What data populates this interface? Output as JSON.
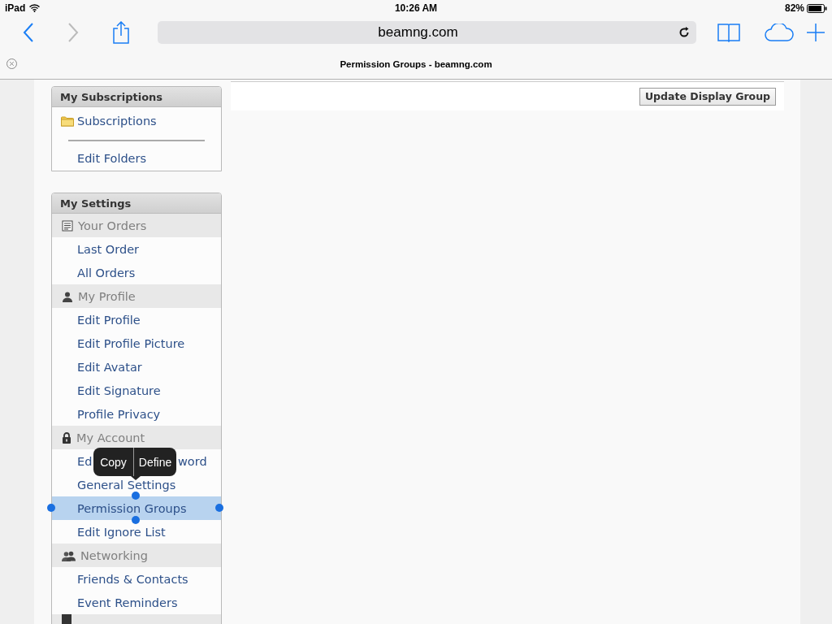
{
  "status_bar": {
    "device": "iPad",
    "time": "10:26 AM",
    "battery": "82%"
  },
  "toolbar": {
    "address": "beamng.com"
  },
  "tab": {
    "title": "Permission Groups - beamng.com"
  },
  "panel": {
    "button": "Update Display Group"
  },
  "sidebar": [
    {
      "title": "My Subscriptions",
      "items": [
        {
          "kind": "folder",
          "label": "Subscriptions",
          "selected": false
        },
        {
          "kind": "divider"
        },
        {
          "kind": "link",
          "label": "Edit Folders",
          "selected": false
        }
      ]
    },
    {
      "title": "My Settings",
      "items": [
        {
          "kind": "section",
          "label": "Your Orders"
        },
        {
          "kind": "link",
          "label": "Last Order",
          "selected": false
        },
        {
          "kind": "link",
          "label": "All Orders",
          "selected": false
        },
        {
          "kind": "section",
          "label": "My Profile"
        },
        {
          "kind": "link",
          "label": "Edit Profile",
          "selected": false
        },
        {
          "kind": "link",
          "label": "Edit Profile Picture",
          "selected": false
        },
        {
          "kind": "link",
          "label": "Edit Avatar",
          "selected": false
        },
        {
          "kind": "link",
          "label": "Edit Signature",
          "selected": false
        },
        {
          "kind": "link",
          "label": "Profile Privacy",
          "selected": false
        },
        {
          "kind": "section",
          "label": "My Account"
        },
        {
          "kind": "link",
          "label_parts": [
            "Ed",
            "word"
          ],
          "selected": false
        },
        {
          "kind": "link",
          "label": "General Settings",
          "selected": false
        },
        {
          "kind": "link",
          "label": "Permission Groups",
          "selected": true
        },
        {
          "kind": "link",
          "label": "Edit Ignore List",
          "selected": false
        },
        {
          "kind": "section",
          "label": "Networking"
        },
        {
          "kind": "link",
          "label": "Friends & Contacts",
          "selected": false
        },
        {
          "kind": "link",
          "label": "Event Reminders",
          "selected": false
        },
        {
          "kind": "section"
        }
      ]
    }
  ],
  "selection_menu": [
    "Copy",
    "Define"
  ]
}
